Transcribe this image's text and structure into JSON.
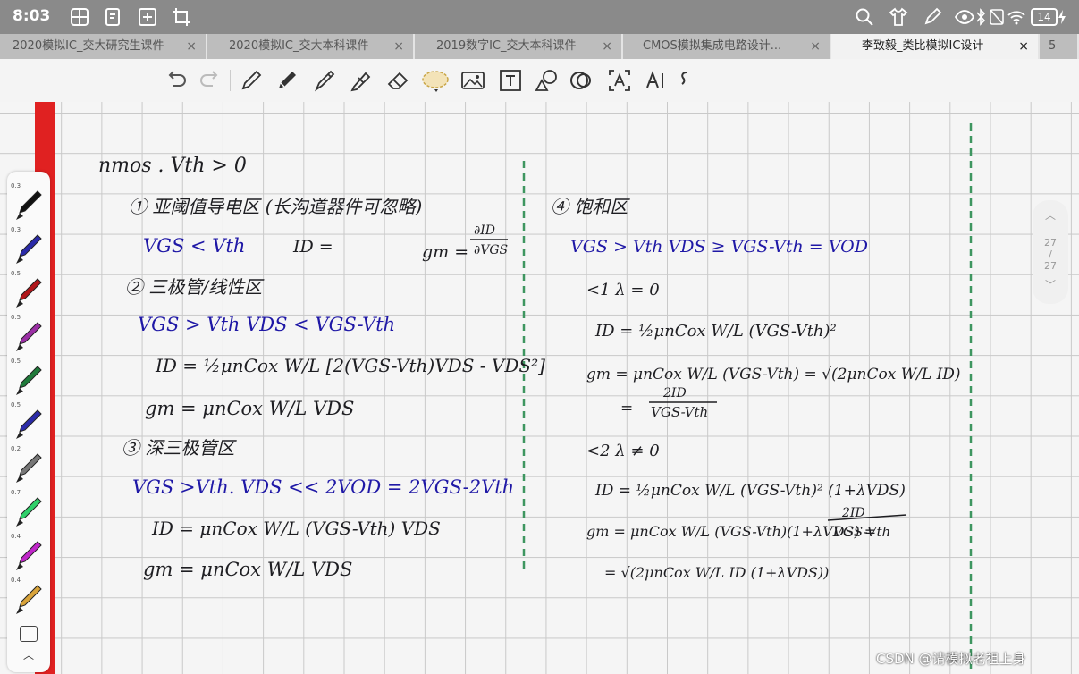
{
  "status_bar": {
    "time": "8:03",
    "battery": "14"
  },
  "tabs": [
    {
      "label": "2020模拟IC_交大研究生课件",
      "close": "×"
    },
    {
      "label": "2020模拟IC_交大本科课件",
      "close": "×"
    },
    {
      "label": "2019数字IC_交大本科课件",
      "close": "×"
    },
    {
      "label": "CMOS模拟集成电路设计...",
      "close": "×"
    },
    {
      "label": "李致毅_类比模拟IC设计",
      "close": "×"
    },
    {
      "label": "5",
      "close": ""
    }
  ],
  "toolbar": {
    "icons": [
      "undo-icon",
      "redo-icon",
      "pen-icon",
      "pencil-icon",
      "brush-icon",
      "highlighter-icon",
      "eraser-icon",
      "lasso-icon",
      "image-icon",
      "text-box-icon",
      "shape-icon",
      "ink-shape-icon",
      "ocr-icon",
      "ai-icon",
      "more-icon",
      "help-icon"
    ]
  },
  "pen_tray": {
    "sizes": [
      "0.3",
      "0.3",
      "0.5",
      "0.5",
      "0.5",
      "0.5",
      "0.2",
      "0.7",
      "0.4",
      "0.4"
    ],
    "colors": [
      "#111111",
      "#2a2aa8",
      "#b0161a",
      "#9b2fa5",
      "#1f7a3a",
      "#2a2aa8",
      "#777777",
      "#2fd06a",
      "#c026c9",
      "#d8a33a"
    ]
  },
  "pager": {
    "current": "27",
    "sep": "/",
    "total": "27"
  },
  "notes": {
    "left": {
      "heading": "nmos . Vth > 0",
      "s1_title": "① 亚阈值导电区 (长沟道器件可忽略)",
      "s1_cond": "VGS < Vth",
      "s1_id": "ID =",
      "s1_gm": "gm =",
      "s1_gm_num": "∂ID",
      "s1_gm_den": "∂VGS",
      "s2_title": "② 三极管/线性区",
      "s2_cond": "VGS > Vth     VDS < VGS-Vth",
      "s2_id": "ID = ½μnCox W/L [2(VGS-Vth)VDS - VDS²]",
      "s2_gm": "gm = μnCox W/L VDS",
      "s3_title": "③ 深三极管区",
      "s3_cond": "VGS >Vth.    VDS << 2VOD = 2VGS-2Vth",
      "s3_id": "ID = μnCox W/L (VGS-Vth) VDS",
      "s3_gm": "gm = μnCox W/L VDS"
    },
    "right": {
      "s4_title": "④ 饱和区",
      "s4_cond": "VGS > Vth      VDS ≥ VGS-Vth = VOD",
      "c1": "<1   λ = 0",
      "c1_id": "ID = ½μnCox W/L (VGS-Vth)²",
      "c1_gm": "gm = μnCox W/L (VGS-Vth) = √(2μnCox W/L ID)",
      "c1_gm2_eq": "=",
      "c1_gm2_num": "2ID",
      "c1_gm2_den": "VGS-Vth",
      "c2": "<2   λ ≠ 0",
      "c2_id": "ID = ½μnCox W/L (VGS-Vth)² (1+λVDS)",
      "c2_gm": "gm = μnCox W/L (VGS-Vth)(1+λVDS) =",
      "c2_gm_num": "2ID",
      "c2_gm_den": "VGS-Vth",
      "c2_gm2": "= √(2μnCox W/L ID (1+λVDS))"
    }
  },
  "watermark": "CSDN @请模拟老祖上身"
}
